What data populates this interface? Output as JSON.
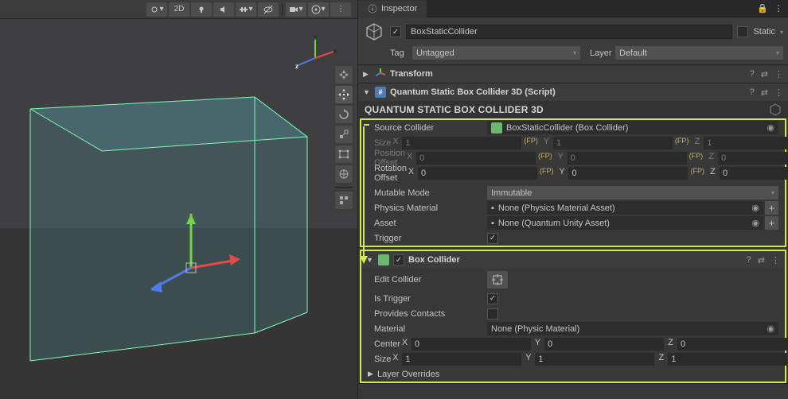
{
  "scene_toolbar": {
    "mode_2d": "2D"
  },
  "inspector_tab": "Inspector",
  "object": {
    "name": "BoxStaticCollider",
    "active": true,
    "static_label": "Static",
    "tag_label": "Tag",
    "tag_value": "Untagged",
    "layer_label": "Layer",
    "layer_value": "Default"
  },
  "transform": {
    "title": "Transform"
  },
  "qscript": {
    "title": "Quantum Static Box Collider 3D (Script)",
    "section": "QUANTUM STATIC BOX COLLIDER 3D",
    "source_label": "Source Collider",
    "source_value": "BoxStaticCollider (Box Collider)",
    "size_label": "Size",
    "size": {
      "x": "1",
      "y": "1",
      "z": "1"
    },
    "pos_off_label": "Position Offset",
    "pos_off": {
      "x": "0",
      "y": "0",
      "z": "0"
    },
    "rot_off_label": "Rotation Offset",
    "rot_off": {
      "x": "0",
      "y": "0",
      "z": "0"
    },
    "mutable_label": "Mutable Mode",
    "mutable_value": "Immutable",
    "physmat_label": "Physics Material",
    "physmat_value": "None (Physics Material Asset)",
    "asset_label": "Asset",
    "asset_value": "None (Quantum Unity Asset)",
    "trigger_label": "Trigger",
    "trigger": true,
    "fp": "(FP)"
  },
  "boxcol": {
    "title": "Box Collider",
    "edit_label": "Edit Collider",
    "istrigger_label": "Is Trigger",
    "istrigger": true,
    "provides_label": "Provides Contacts",
    "provides": false,
    "material_label": "Material",
    "material_value": "None (Physic Material)",
    "center_label": "Center",
    "center": {
      "x": "0",
      "y": "0",
      "z": "0"
    },
    "bsize_label": "Size",
    "bsize": {
      "x": "1",
      "y": "1",
      "z": "1"
    },
    "layerov_label": "Layer Overrides"
  },
  "axis_labels": {
    "x": "X",
    "y": "Y",
    "z": "Z"
  }
}
